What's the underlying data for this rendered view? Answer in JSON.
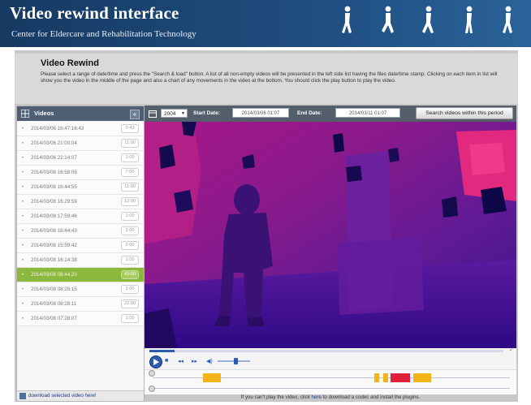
{
  "header": {
    "title": "Video rewind interface",
    "subtitle": "Center for Eldercare and Rehabilitation Technology",
    "bg_color": "#1f4e80"
  },
  "intro": {
    "heading": "Video Rewind",
    "text": "Please select a range of date/time and press the \"Search & load\" button. A list of all non-empty videos will be presented in the left side list having the files date/time stamp. Clicking on each item in list will show you the video in the middle of the page and also a chart of any movements in the video at the bottom. You should click the play button to play the video."
  },
  "sidebar": {
    "header_label": "Videos",
    "header_icon": "grid-icon",
    "collapse_icon": "chevron-left-icon",
    "selected_color": "#8cb83c",
    "items": [
      {
        "timestamp": "2014/03/06 16:47:16:43",
        "duration": "0:43"
      },
      {
        "timestamp": "2014/03/06 21:00:04",
        "duration": "11:00"
      },
      {
        "timestamp": "2014/03/06 22:14:07",
        "duration": "1:00"
      },
      {
        "timestamp": "2014/03/08 16:58:06",
        "duration": "7:00"
      },
      {
        "timestamp": "2014/03/08 16:44:55",
        "duration": "11:00"
      },
      {
        "timestamp": "2014/03/08 16:29:59",
        "duration": "13:00"
      },
      {
        "timestamp": "2014/03/08 17:59:46",
        "duration": "1:00"
      },
      {
        "timestamp": "2014/03/08 16:44:43",
        "duration": "1:00"
      },
      {
        "timestamp": "2014/03/08 15:59:42",
        "duration": "2:00"
      },
      {
        "timestamp": "2014/03/08 16:14:38",
        "duration": "1:00"
      },
      {
        "timestamp": "2014/03/08 08:44:20",
        "duration": "43:00",
        "selected": true
      },
      {
        "timestamp": "2014/03/08 08:28:15",
        "duration": "1:00"
      },
      {
        "timestamp": "2014/03/08 08:28:11",
        "duration": "22:00"
      },
      {
        "timestamp": "2014/03/08 07:28:07",
        "duration": "1:00"
      }
    ],
    "download_label": "download selected video here!",
    "download_icon": "download-icon"
  },
  "toolbar": {
    "year": "2004",
    "start_label": "Start Date:",
    "start_value": "2014/03/06 01:07",
    "end_label": "End Date:",
    "end_value": "2014/03/11 01:07",
    "search_button": "Search videos within this period"
  },
  "player": {
    "progress_fraction": 0.07,
    "volume_fraction": 0.55,
    "play_icon": "play-icon",
    "stop_icon": "stop-icon",
    "rewind_icon": "rewind-icon",
    "forward_icon": "forward-icon",
    "volume_icon": "volume-icon",
    "fullscreen_icon": "fullscreen-icon"
  },
  "movement_chart": {
    "blocks": [
      {
        "start": 0.14,
        "end": 0.19,
        "color": "#f2b418"
      },
      {
        "start": 0.62,
        "end": 0.635,
        "color": "#f2b418"
      },
      {
        "start": 0.645,
        "end": 0.66,
        "color": "#f2b418"
      },
      {
        "start": 0.665,
        "end": 0.72,
        "color": "#e0203a"
      },
      {
        "start": 0.73,
        "end": 0.78,
        "color": "#f2b418"
      }
    ]
  },
  "footer": {
    "pre": "If you can't play the video, click ",
    "link": "here",
    "post": " to download a codec and install the plugins."
  }
}
